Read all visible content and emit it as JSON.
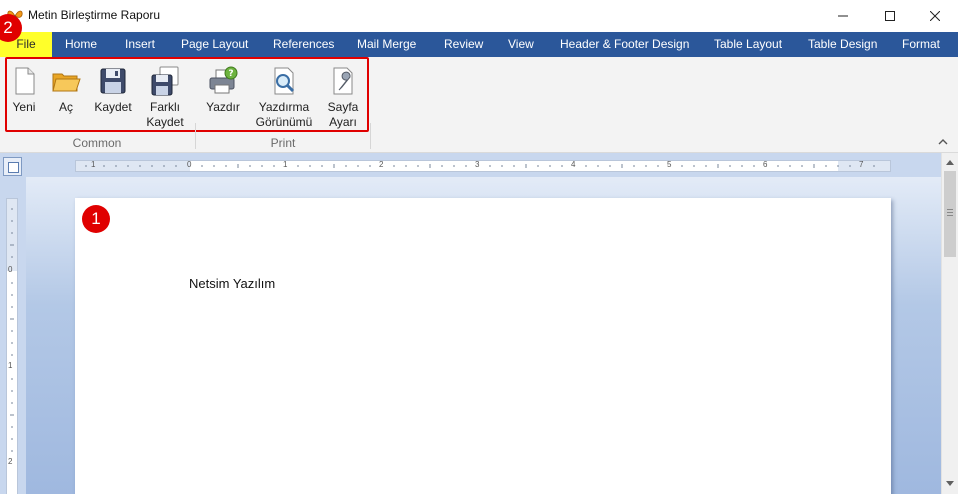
{
  "window": {
    "title": "Metin Birleştirme Raporu",
    "minimize_icon": "minimize-icon",
    "maximize_icon": "maximize-icon",
    "close_icon": "close-icon"
  },
  "tabs": [
    {
      "label": "File",
      "active": true
    },
    {
      "label": "Home"
    },
    {
      "label": "Insert"
    },
    {
      "label": "Page Layout"
    },
    {
      "label": "References"
    },
    {
      "label": "Mail Merge"
    },
    {
      "label": "Review"
    },
    {
      "label": "View"
    },
    {
      "label": "Header & Footer Design"
    },
    {
      "label": "Table Layout"
    },
    {
      "label": "Table Design"
    },
    {
      "label": "Format"
    }
  ],
  "ribbon": {
    "common": {
      "label": "Common",
      "buttons": [
        {
          "line1": "Yeni",
          "line2": "",
          "icon": "new-document-icon"
        },
        {
          "line1": "Aç",
          "line2": "",
          "icon": "open-folder-icon"
        },
        {
          "line1": "Kaydet",
          "line2": "",
          "icon": "save-icon"
        },
        {
          "line1": "Farklı",
          "line2": "Kaydet",
          "icon": "save-as-icon"
        }
      ]
    },
    "print": {
      "label": "Print",
      "buttons": [
        {
          "line1": "Yazdır",
          "line2": "",
          "icon": "printer-icon"
        },
        {
          "line1": "Yazdırma",
          "line2": "Görünümü",
          "icon": "print-preview-icon"
        },
        {
          "line1": "Sayfa",
          "line2": "Ayarı",
          "icon": "page-setup-icon"
        }
      ]
    }
  },
  "badges": {
    "document": "1",
    "file_tab": "2"
  },
  "colors": {
    "tab_bar": "#2b579a",
    "file_tab": "#ffff2a",
    "highlight": "#e00000"
  },
  "document": {
    "text": "Netsim Yazılım"
  },
  "ruler": {
    "h_labels": [
      "1",
      "0",
      "1",
      "2",
      "3",
      "4",
      "5",
      "6",
      "7"
    ],
    "v_labels": [
      "0",
      "1",
      "2"
    ]
  }
}
